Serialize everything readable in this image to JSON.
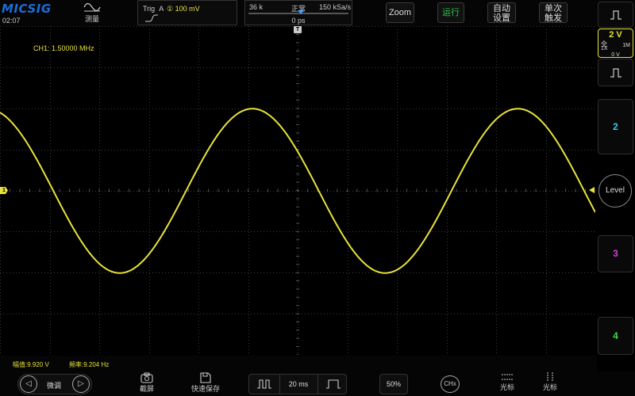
{
  "header": {
    "logo": "MICSIG",
    "time": "02:07",
    "measure_label": "测量",
    "trigger": {
      "label": "Trig",
      "source": "A",
      "level": "① 100 mV"
    },
    "timebase": {
      "memory": "36 k",
      "mode": "正常",
      "sample_rate": "150 kSa/s",
      "offset": "0 ps"
    },
    "zoom_label": "Zoom",
    "run_label": "运行",
    "auto_label_1": "自动",
    "auto_label_2": "设置",
    "single_label_1": "单次",
    "single_label_2": "触发"
  },
  "channel_panel": {
    "volts_div": "2 V",
    "coupling_1": "全",
    "probe": "1X",
    "impedance": "1M",
    "offset": "0 V",
    "ch2": "2",
    "ch3": "3",
    "ch4": "4",
    "level_label": "Level"
  },
  "waveform": {
    "label": "CH1: 1.50000 MHz",
    "ch1_marker": "1",
    "trigger_marker": "T",
    "color": "#e8e23a",
    "amplitude_div": 2.0,
    "period_div": 5.35
  },
  "stats": {
    "amplitude": "幅值:9.920 V",
    "frequency": "频率:9.204 Hz"
  },
  "bottom": {
    "fine_label": "微调",
    "screenshot_label": "截屏",
    "quick_save_label": "快速保存",
    "timebase_value": "20 ms",
    "trigger_pos": "50%",
    "chx_label": "CHx",
    "cursor1_label": "光标",
    "cursor2_label": "光标"
  },
  "colors": {
    "ch1": "#e8e23a",
    "ch2": "#3ac7e8",
    "ch3": "#d83ad8",
    "ch4": "#3ad84a",
    "run": "#2ec84a",
    "logo": "#1a6fd6"
  }
}
